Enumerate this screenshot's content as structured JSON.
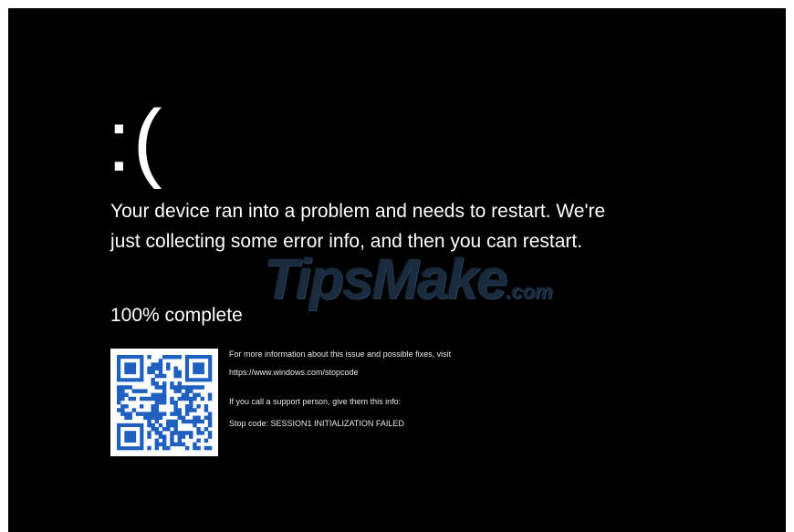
{
  "screen": {
    "frown": ":(",
    "message": "Your device ran into a problem and needs to restart. We're just collecting some error info, and then you can restart.",
    "progress": "100% complete"
  },
  "info": {
    "more_info": "For more information about this issue and possible fixes, visit",
    "url": "https://www.windows.com/stopcode",
    "support": "If you call a support person, give them this info:",
    "stop_code": "Stop code: SESSION1 INITIALIZATION FAILED"
  },
  "watermark": {
    "brand": "TipsMake",
    "tld": ".com"
  },
  "colors": {
    "background": "#000000",
    "text": "#ffffff",
    "qr": "#1e5fbf"
  }
}
